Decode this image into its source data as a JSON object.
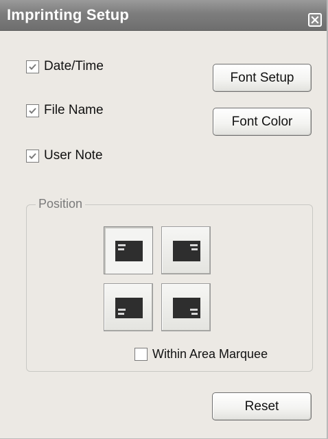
{
  "window": {
    "title": "Imprinting Setup",
    "close_icon": "close-icon"
  },
  "options": [
    {
      "label": "Date/Time",
      "checked": true
    },
    {
      "label": "File Name",
      "checked": true
    },
    {
      "label": "User Note",
      "checked": true
    }
  ],
  "buttons": {
    "font_setup": "Font Setup",
    "font_color": "Font Color",
    "reset": "Reset"
  },
  "position": {
    "group_label": "Position",
    "buttons": [
      {
        "name": "top-left",
        "selected": true
      },
      {
        "name": "top-right",
        "selected": false
      },
      {
        "name": "bottom-left",
        "selected": false
      },
      {
        "name": "bottom-right",
        "selected": false
      }
    ],
    "within_area_marquee": {
      "label": "Within Area Marquee",
      "checked": false
    }
  },
  "colors": {
    "titlebar": "#7d7d7d",
    "window_bg": "#ece9e4"
  }
}
